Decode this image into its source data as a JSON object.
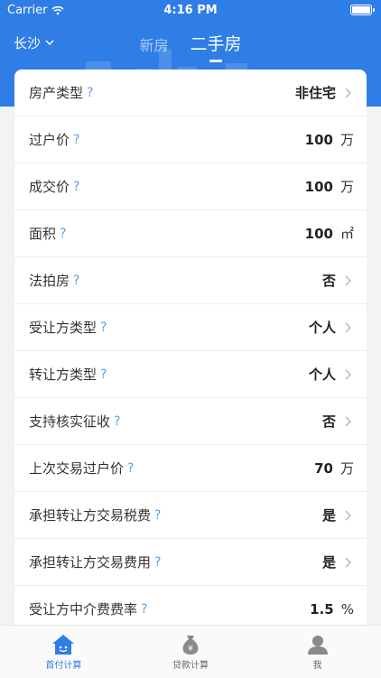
{
  "status_bar": {
    "carrier": "Carrier",
    "time": "4:16 PM"
  },
  "header": {
    "city": "长沙",
    "tabs": [
      {
        "label": "新房",
        "active": false
      },
      {
        "label": "二手房",
        "active": true
      }
    ]
  },
  "help_mark": "?",
  "rows": [
    {
      "label": "房产类型",
      "value": "非住宅",
      "unit": "",
      "chevron": true
    },
    {
      "label": "过户价",
      "value": "100",
      "unit": "万",
      "chevron": false
    },
    {
      "label": "成交价",
      "value": "100",
      "unit": "万",
      "chevron": false
    },
    {
      "label": "面积",
      "value": "100",
      "unit": "㎡",
      "chevron": false
    },
    {
      "label": "法拍房",
      "value": "否",
      "unit": "",
      "chevron": true
    },
    {
      "label": "受让方类型",
      "value": "个人",
      "unit": "",
      "chevron": true
    },
    {
      "label": "转让方类型",
      "value": "个人",
      "unit": "",
      "chevron": true
    },
    {
      "label": "支持核实征收",
      "value": "否",
      "unit": "",
      "chevron": true
    },
    {
      "label": "上次交易过户价",
      "value": "70",
      "unit": "万",
      "chevron": false
    },
    {
      "label": "承担转让方交易税费",
      "value": "是",
      "unit": "",
      "chevron": true
    },
    {
      "label": "承担转让方交易费用",
      "value": "是",
      "unit": "",
      "chevron": true
    },
    {
      "label": "受让方中介费费率",
      "value": "1.5",
      "unit": "%",
      "chevron": false
    }
  ],
  "tabbar": [
    {
      "label": "首付计算",
      "icon": "house-icon",
      "active": true
    },
    {
      "label": "贷款计算",
      "icon": "money-bag-icon",
      "active": false
    },
    {
      "label": "我",
      "icon": "person-icon",
      "active": false
    }
  ],
  "colors": {
    "primary": "#2f7de6",
    "help": "#5aa0e6",
    "background": "#f2f3f5"
  }
}
